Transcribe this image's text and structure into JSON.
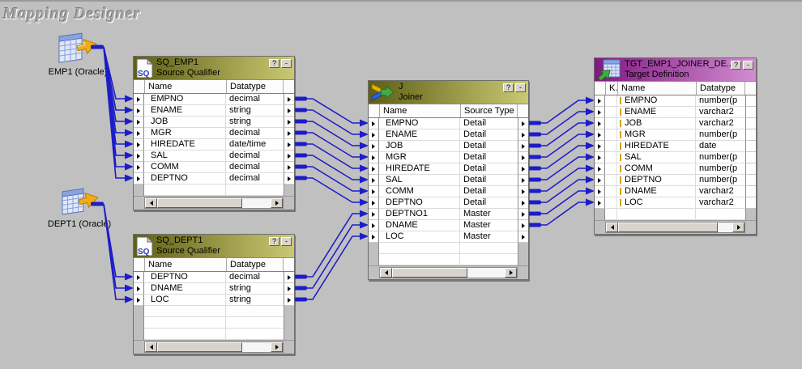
{
  "app": {
    "title": "Mapping Designer"
  },
  "window_buttons": {
    "help": "?",
    "minimize": "-"
  },
  "colors": {
    "canvas": "#c0c0c0",
    "connector_blue": "#1c1cc8",
    "qualifier_header_left": "#5f5f14",
    "qualifier_header_right": "#c9c973",
    "target_header_left": "#801880",
    "target_header_right": "#d28cd2"
  },
  "icons": {
    "source_table": "table-with-yellow-arrow-icon",
    "source_qualifier": "sq-document-icon",
    "joiner": "merging-arrows-icon",
    "target_table": "table-with-green-arrow-icon",
    "port": "small-right-triangle"
  },
  "sources": [
    {
      "id": "emp1",
      "label": "EMP1 (Oracle)"
    },
    {
      "id": "dept1",
      "label": "DEPT1 (Oracle)"
    }
  ],
  "transformations": {
    "sq_emp1": {
      "title": "SQ_EMP1",
      "subtitle": "Source Qualifier",
      "columns": [
        "Name",
        "Datatype"
      ],
      "rows": [
        {
          "name": "EMPNO",
          "type": "decimal"
        },
        {
          "name": "ENAME",
          "type": "string"
        },
        {
          "name": "JOB",
          "type": "string"
        },
        {
          "name": "MGR",
          "type": "decimal"
        },
        {
          "name": "HIREDATE",
          "type": "date/time"
        },
        {
          "name": "SAL",
          "type": "decimal"
        },
        {
          "name": "COMM",
          "type": "decimal"
        },
        {
          "name": "DEPTNO",
          "type": "decimal"
        }
      ]
    },
    "sq_dept1": {
      "title": "SQ_DEPT1",
      "subtitle": "Source Qualifier",
      "columns": [
        "Name",
        "Datatype"
      ],
      "rows": [
        {
          "name": "DEPTNO",
          "type": "decimal"
        },
        {
          "name": "DNAME",
          "type": "string"
        },
        {
          "name": "LOC",
          "type": "string"
        }
      ]
    },
    "joiner": {
      "title": "J",
      "subtitle": "Joiner",
      "columns": [
        "Name",
        "Source Type"
      ],
      "rows": [
        {
          "name": "EMPNO",
          "type": "Detail"
        },
        {
          "name": "ENAME",
          "type": "Detail"
        },
        {
          "name": "JOB",
          "type": "Detail"
        },
        {
          "name": "MGR",
          "type": "Detail"
        },
        {
          "name": "HIREDATE",
          "type": "Detail"
        },
        {
          "name": "SAL",
          "type": "Detail"
        },
        {
          "name": "COMM",
          "type": "Detail"
        },
        {
          "name": "DEPTNO",
          "type": "Detail"
        },
        {
          "name": "DEPTNO1",
          "type": "Master"
        },
        {
          "name": "DNAME",
          "type": "Master"
        },
        {
          "name": "LOC",
          "type": "Master"
        }
      ]
    },
    "target": {
      "title": "TGT_EMP1_JOINER_DE...",
      "subtitle": "Target Definition",
      "columns": [
        "K.",
        "Name",
        "Datatype"
      ],
      "rows": [
        {
          "name": "EMPNO",
          "type": "number(p"
        },
        {
          "name": "ENAME",
          "type": "varchar2"
        },
        {
          "name": "JOB",
          "type": "varchar2"
        },
        {
          "name": "MGR",
          "type": "number(p"
        },
        {
          "name": "HIREDATE",
          "type": "date"
        },
        {
          "name": "SAL",
          "type": "number(p"
        },
        {
          "name": "COMM",
          "type": "number(p"
        },
        {
          "name": "DEPTNO",
          "type": "number(p"
        },
        {
          "name": "DNAME",
          "type": "varchar2"
        },
        {
          "name": "LOC",
          "type": "varchar2"
        }
      ]
    }
  },
  "connections": {
    "source_links": [
      {
        "from": "emp1",
        "to": "sq_emp1",
        "rows": [
          0,
          1,
          2,
          3,
          4,
          5,
          6,
          7
        ]
      },
      {
        "from": "dept1",
        "to": "sq_dept1",
        "rows": [
          0,
          1,
          2
        ]
      }
    ],
    "port_links": [
      {
        "from": "sq_emp1",
        "to": "joiner",
        "pairs": [
          [
            0,
            0
          ],
          [
            1,
            1
          ],
          [
            2,
            2
          ],
          [
            3,
            3
          ],
          [
            4,
            4
          ],
          [
            5,
            5
          ],
          [
            6,
            6
          ],
          [
            7,
            7
          ]
        ]
      },
      {
        "from": "sq_dept1",
        "to": "joiner",
        "pairs": [
          [
            0,
            8
          ],
          [
            1,
            9
          ],
          [
            2,
            10
          ]
        ]
      },
      {
        "from": "joiner",
        "to": "target",
        "pairs": [
          [
            0,
            0
          ],
          [
            1,
            1
          ],
          [
            2,
            2
          ],
          [
            3,
            3
          ],
          [
            4,
            4
          ],
          [
            5,
            5
          ],
          [
            6,
            6
          ],
          [
            7,
            7
          ],
          [
            8,
            8
          ],
          [
            9,
            9
          ]
        ]
      }
    ]
  }
}
